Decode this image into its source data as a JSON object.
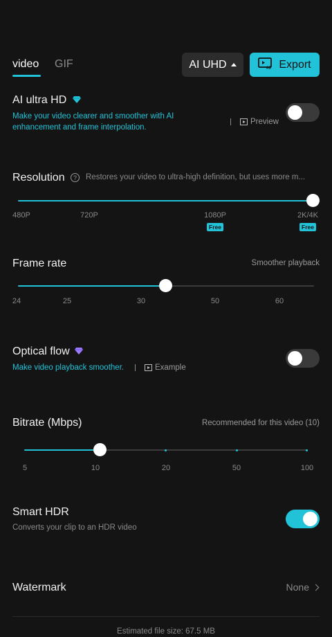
{
  "tabs": [
    {
      "label": "video",
      "active": true
    },
    {
      "label": "GIF",
      "active": false
    }
  ],
  "quality_button": {
    "label": "AI UHD"
  },
  "export_button": {
    "label": "Export"
  },
  "ai_ultra_hd": {
    "title": "AI ultra HD",
    "description": "Make your video clearer and smoother with AI enhancement and frame interpolation.",
    "desc_line1": "Make your video clearer and smoother with AI",
    "desc_line2": "enhancement and frame interpolation.",
    "preview_label": "Preview",
    "enabled": false
  },
  "resolution": {
    "title": "Resolution",
    "hint": "Restores your video to ultra-high definition, but uses more m...",
    "options": [
      "480P",
      "720P",
      "1080P",
      "2K/4K"
    ],
    "selected": "2K/4K",
    "free_badge": "Free"
  },
  "frame_rate": {
    "title": "Frame rate",
    "note": "Smoother playback",
    "options": [
      "24",
      "25",
      "30",
      "50",
      "60"
    ],
    "selected": "30"
  },
  "optical_flow": {
    "title": "Optical flow",
    "description": "Make video playback smoother.",
    "example_label": "Example",
    "enabled": false
  },
  "bitrate": {
    "title": "Bitrate (Mbps)",
    "note": "Recommended for this video (10)",
    "options": [
      "5",
      "10",
      "20",
      "50",
      "100"
    ],
    "selected": "10"
  },
  "smart_hdr": {
    "title": "Smart HDR",
    "description": "Converts your clip to an HDR video",
    "enabled": true
  },
  "watermark": {
    "title": "Watermark",
    "value": "None"
  },
  "footer": {
    "estimated_size": "Estimated file size: 67.5 MB"
  },
  "colors": {
    "accent": "#22c3d8",
    "background": "#141414",
    "premium_gem": "#22c3d8",
    "optical_gem": "#9b7bff"
  },
  "icons": [
    "chevron-up-icon",
    "export-ad-icon",
    "diamond-icon",
    "play-preview-icon",
    "help-icon",
    "chevron-right-icon"
  ]
}
